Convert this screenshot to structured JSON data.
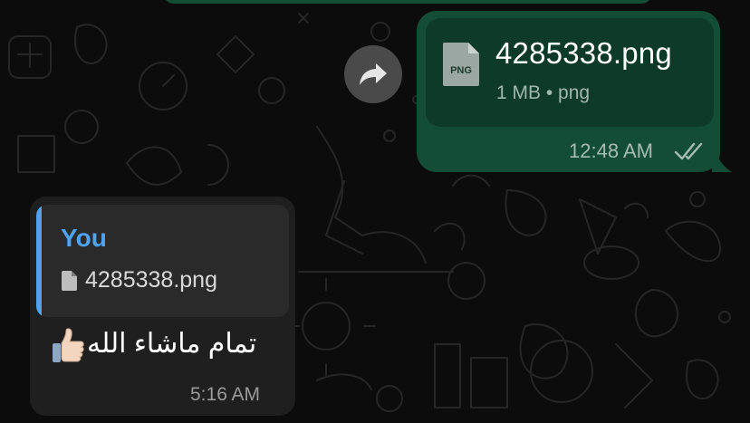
{
  "outgoing_message": {
    "file_type_badge": "PNG",
    "file_name": "4285338.png",
    "file_meta": "1 MB • png",
    "time": "12:48 AM",
    "status": "read"
  },
  "incoming_message": {
    "quote_author": "You",
    "quote_file_name": "4285338.png",
    "text": "تمام ماشاء الله",
    "emoji": "👍🏻",
    "time": "5:16 AM"
  },
  "colors": {
    "outgoing_bubble": "#144d37",
    "incoming_bubble": "#1f1f1f",
    "quote_accent": "#4fa3f5",
    "background": "#0b0b0b"
  },
  "icons": {
    "forward": "forward-arrow-icon",
    "file": "png-file-icon",
    "read_receipt": "double-check-icon",
    "quote_doc": "document-icon"
  }
}
